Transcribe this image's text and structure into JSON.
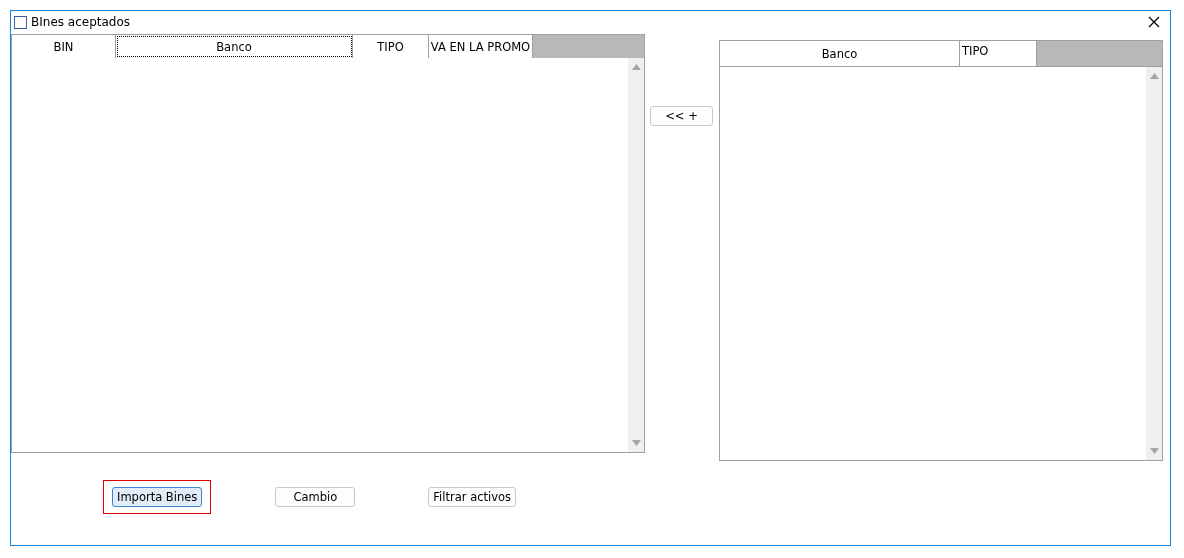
{
  "window": {
    "title": "BInes aceptados"
  },
  "left_table": {
    "columns": [
      {
        "label": "BIN",
        "focused": false
      },
      {
        "label": "Banco",
        "focused": true
      },
      {
        "label": "TIPO",
        "focused": false
      },
      {
        "label": "VA EN LA PROMO",
        "focused": false
      }
    ]
  },
  "move_button": {
    "label": "<<  +"
  },
  "right_table": {
    "columns": [
      {
        "label": "Banco",
        "focused": false
      },
      {
        "label": "TIPO",
        "focused": false
      }
    ]
  },
  "buttons": [
    {
      "label": "Importa Bines",
      "focused": true,
      "highlighted": true
    },
    {
      "label": "Cambio",
      "focused": false,
      "highlighted": false
    },
    {
      "label": "Filtrar activos",
      "focused": false,
      "highlighted": false
    }
  ]
}
